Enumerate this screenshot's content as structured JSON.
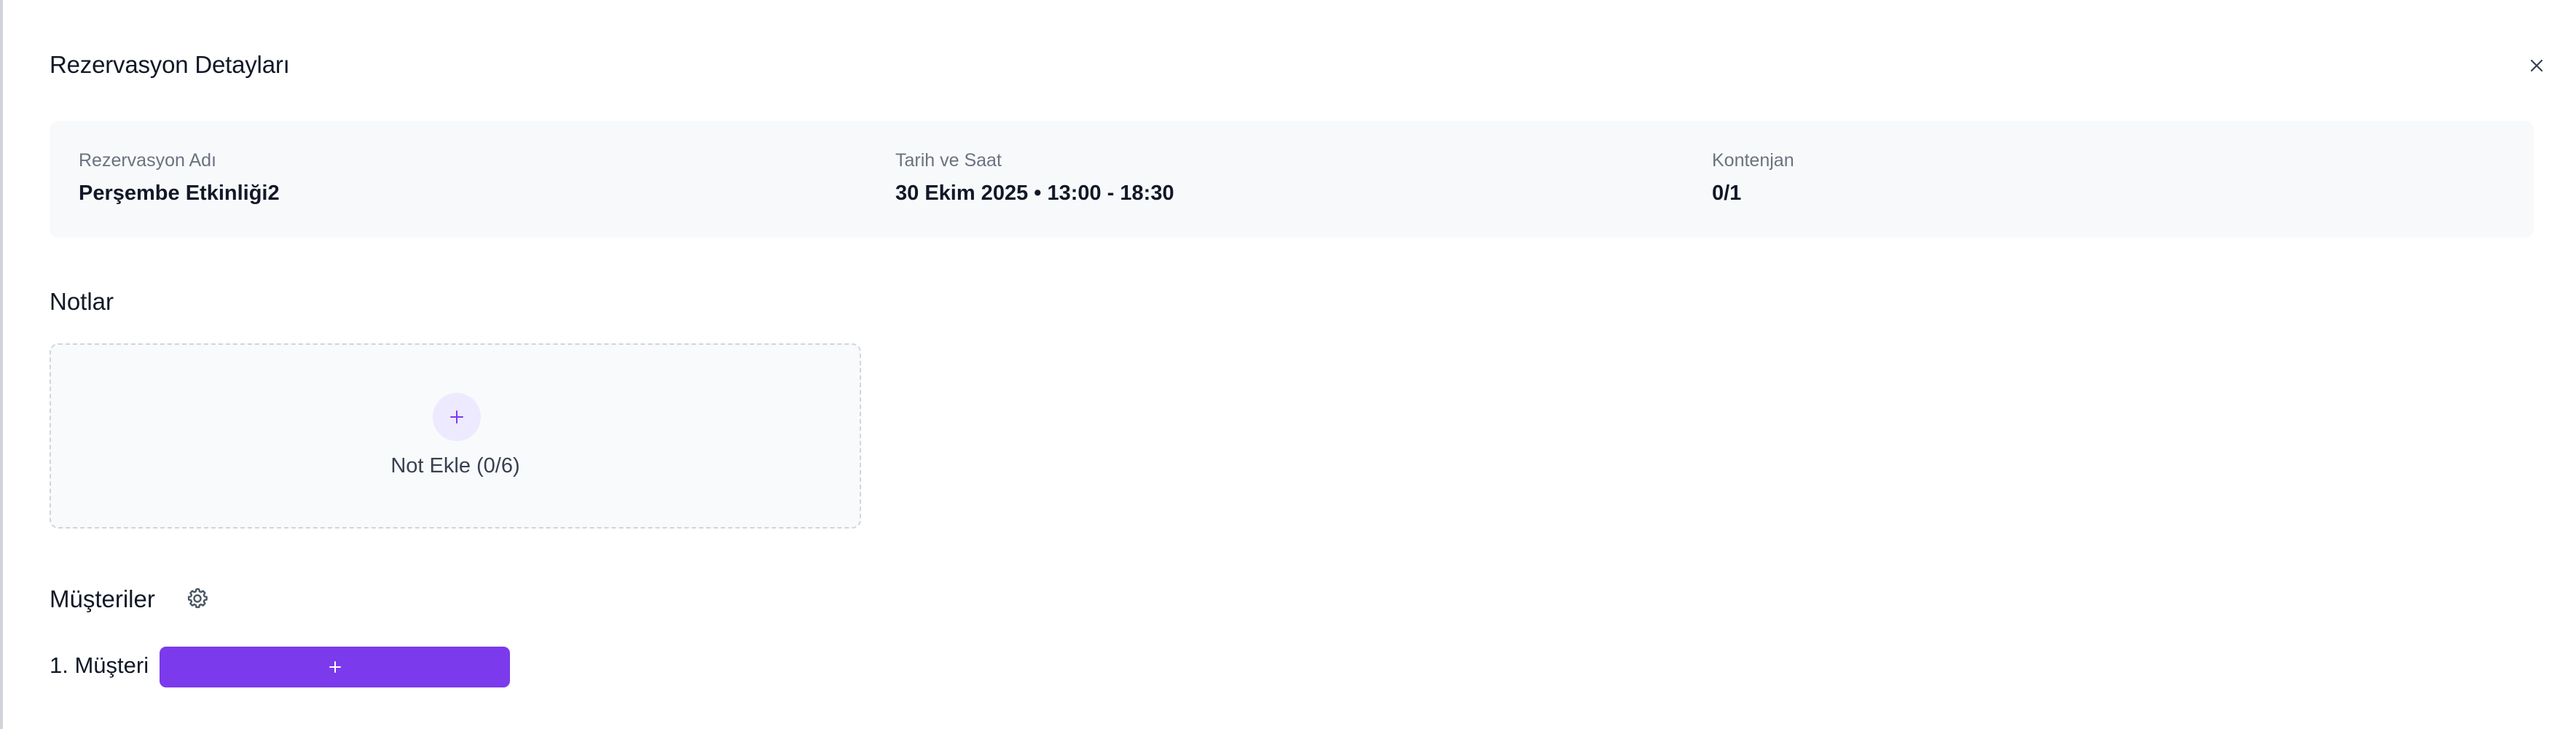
{
  "modal": {
    "title": "Rezervasyon Detayları",
    "close_icon": "close-icon"
  },
  "info": {
    "name_label": "Rezervasyon Adı",
    "name_value": "Perşembe Etkinliği2",
    "datetime_label": "Tarih ve Saat",
    "datetime_value": "30 Ekim 2025 • 13:00 - 18:30",
    "capacity_label": "Kontenjan",
    "capacity_value": "0/1"
  },
  "notes": {
    "title": "Notlar",
    "add_label": "Not Ekle (0/6)",
    "add_icon": "plus-icon"
  },
  "customers": {
    "title": "Müşteriler",
    "settings_icon": "gear-icon",
    "rows": [
      {
        "label": "1. Müşteri",
        "add_icon": "plus-icon"
      }
    ]
  },
  "colors": {
    "accent": "#7c3aed",
    "accent_light": "#ede9fe",
    "card_bg": "#f8f9fb"
  }
}
